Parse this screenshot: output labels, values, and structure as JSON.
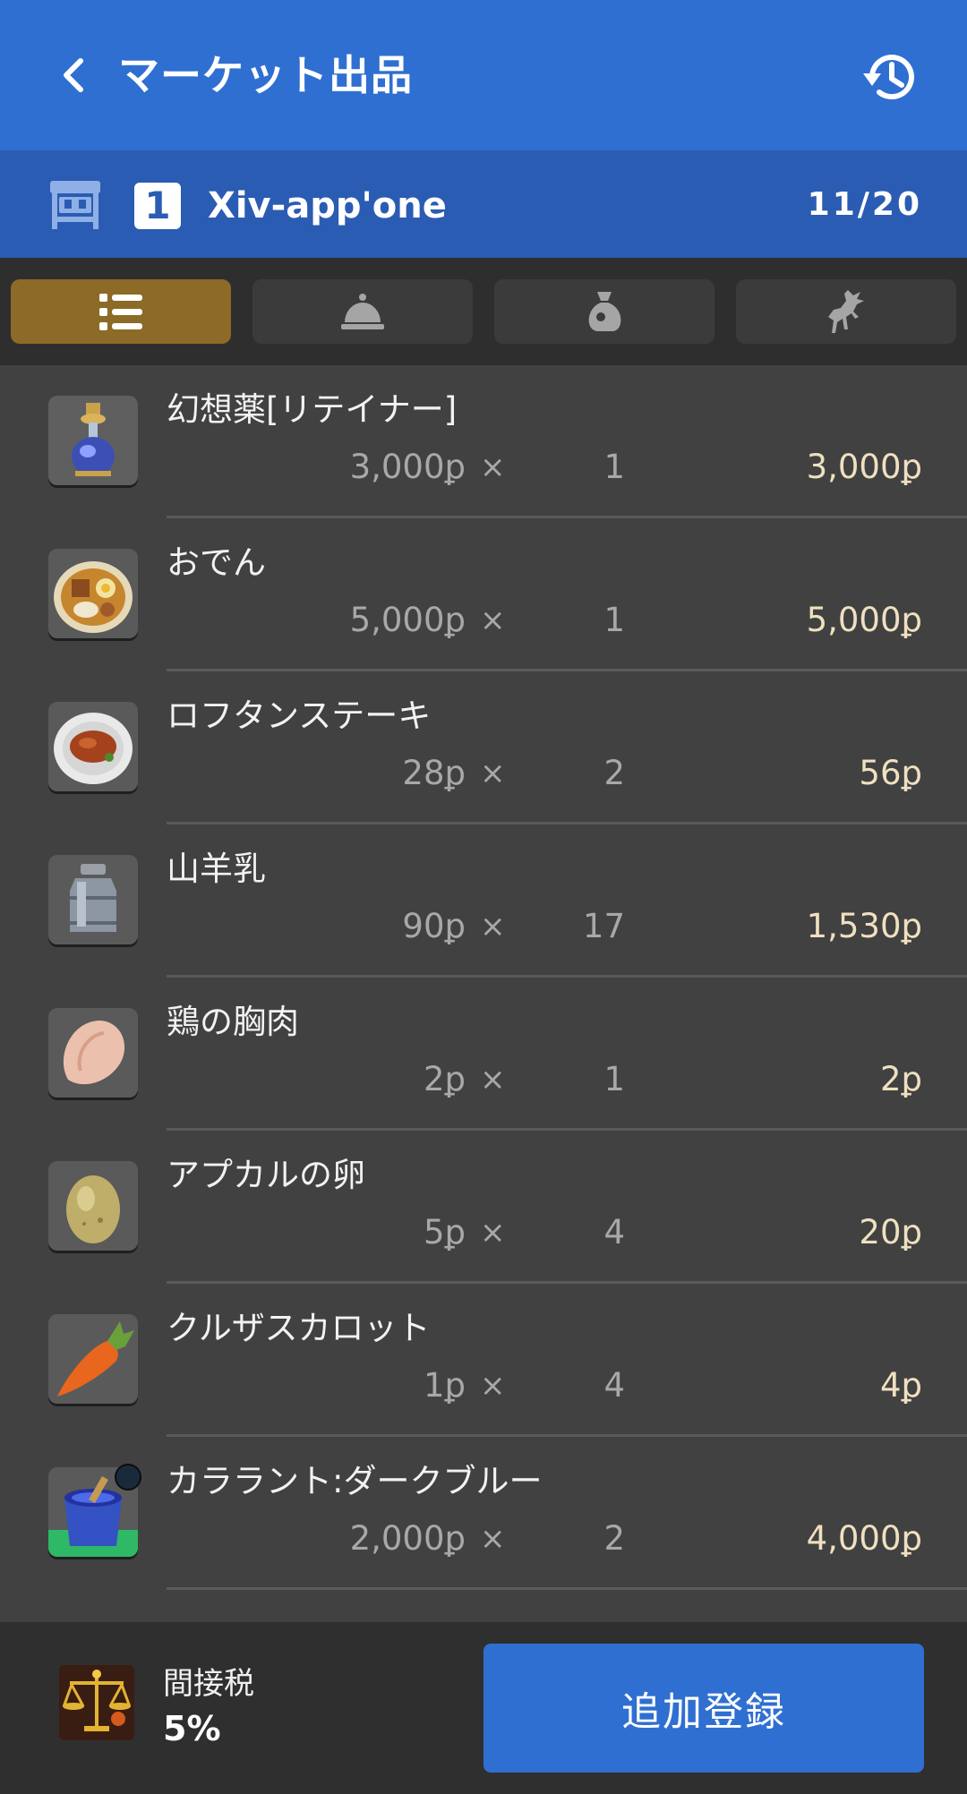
{
  "header": {
    "title": "マーケット出品",
    "back_icon": "chevron-left-icon",
    "history_icon": "history-icon"
  },
  "retainer": {
    "stall_icon": "market-stall-icon",
    "number": "1",
    "name": "Xiv-app'one",
    "slots": "11/20"
  },
  "tabs": [
    {
      "icon": "list-icon",
      "active": true
    },
    {
      "icon": "service-bell-icon",
      "active": false
    },
    {
      "icon": "money-bag-icon",
      "active": false
    },
    {
      "icon": "chocobo-icon",
      "active": false
    }
  ],
  "items": [
    {
      "name": "幻想薬[リテイナー]",
      "unit_price": "3,000ꝑ",
      "times": "×",
      "quantity": "1",
      "total": "3,000ꝑ",
      "icon": "potion-icon"
    },
    {
      "name": "おでん",
      "unit_price": "5,000ꝑ",
      "times": "×",
      "quantity": "1",
      "total": "5,000ꝑ",
      "icon": "oden-icon"
    },
    {
      "name": "ロフタンステーキ",
      "unit_price": "28ꝑ",
      "times": "×",
      "quantity": "2",
      "total": "56ꝑ",
      "icon": "steak-icon"
    },
    {
      "name": "山羊乳",
      "unit_price": "90ꝑ",
      "times": "×",
      "quantity": "17",
      "total": "1,530ꝑ",
      "icon": "milk-can-icon"
    },
    {
      "name": "鶏の胸肉",
      "unit_price": "2ꝑ",
      "times": "×",
      "quantity": "1",
      "total": "2ꝑ",
      "icon": "chicken-breast-icon"
    },
    {
      "name": "アプカルの卵",
      "unit_price": "5ꝑ",
      "times": "×",
      "quantity": "4",
      "total": "20ꝑ",
      "icon": "egg-icon"
    },
    {
      "name": "クルザスカロット",
      "unit_price": "1ꝑ",
      "times": "×",
      "quantity": "4",
      "total": "4ꝑ",
      "icon": "carrot-icon"
    },
    {
      "name": "カララント:ダークブルー",
      "unit_price": "2,000ꝑ",
      "times": "×",
      "quantity": "2",
      "total": "4,000ꝑ",
      "icon": "dye-pot-icon"
    }
  ],
  "footer": {
    "tax_icon": "scales-icon",
    "tax_label": "間接税",
    "tax_value": "5%",
    "add_button_label": "追加登録"
  },
  "colors": {
    "header_blue": "#2f6fd1",
    "retainer_bar_blue": "#2b5cb3",
    "active_tab": "#8c6a27",
    "list_background": "#414141",
    "total_text": "#efe0c0"
  }
}
